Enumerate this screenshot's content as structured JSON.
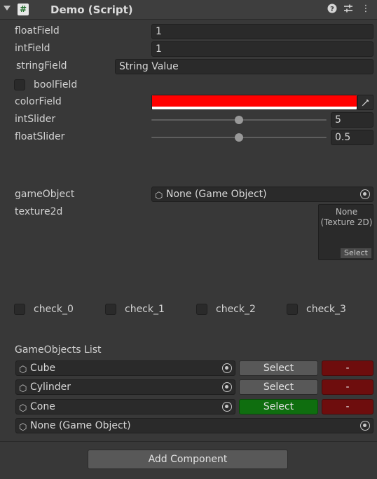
{
  "header": {
    "title": "Demo (Script)",
    "script_glyph": "#",
    "help_glyph": "?",
    "presets_glyph": "⇄",
    "menu_glyph": "⋮"
  },
  "fields": {
    "float_field": {
      "label": "floatField",
      "value": "1"
    },
    "int_field": {
      "label": "intField",
      "value": "1"
    },
    "string_field": {
      "label": "stringField",
      "value": "String Value"
    },
    "bool_field": {
      "label": "boolField",
      "checked": false
    },
    "color_field": {
      "label": "colorField",
      "value": "#ff0000"
    },
    "int_slider": {
      "label": "intSlider",
      "value": "5",
      "fraction": 0.5
    },
    "float_slider": {
      "label": "floatSlider",
      "value": "0.5",
      "fraction": 0.5
    },
    "game_object": {
      "label": "gameObject",
      "value": "None (Game Object)"
    },
    "texture2d": {
      "label": "texture2d",
      "line1": "None",
      "line2": "(Texture 2D)",
      "select": "Select"
    }
  },
  "checks": [
    {
      "label": "check_0",
      "checked": false
    },
    {
      "label": "check_1",
      "checked": false
    },
    {
      "label": "check_2",
      "checked": false
    },
    {
      "label": "check_3",
      "checked": false
    }
  ],
  "list": {
    "title": "GameObjects List",
    "items": [
      {
        "name": "Cube",
        "select": "Select",
        "remove": "-",
        "selected": false
      },
      {
        "name": "Cylinder",
        "select": "Select",
        "remove": "-",
        "selected": false
      },
      {
        "name": "Cone",
        "select": "Select",
        "remove": "-",
        "selected": true
      }
    ],
    "new_item": "None (Game Object)"
  },
  "add_component": "Add Component",
  "colors": {
    "background": "#383838",
    "select_active": "#0f6e0f",
    "remove": "#6e0d0d"
  }
}
